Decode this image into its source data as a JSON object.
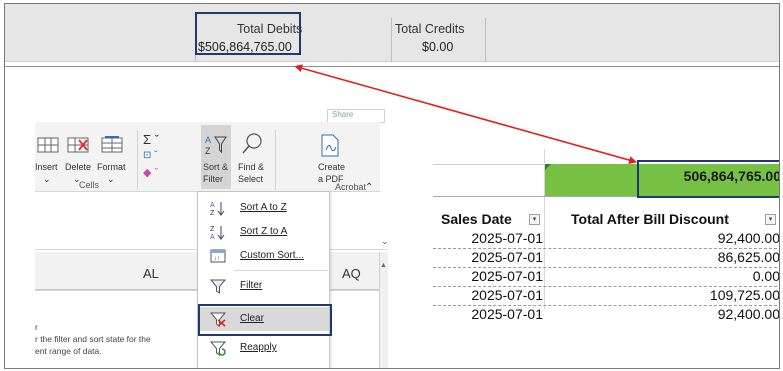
{
  "totals": {
    "debits_label": "Total Debits",
    "debits_value": "$506,864,765.00",
    "credits_label": "Total Credits",
    "credits_value": "$0.00"
  },
  "ribbon": {
    "share_label": "Share",
    "insert": "Insert",
    "delete": "Delete",
    "format": "Format",
    "cells_group": "Cells",
    "sort_filter_1": "Sort &",
    "sort_filter_2": "Filter",
    "find_select_1": "Find &",
    "find_select_2": "Select",
    "create_pdf_1": "Create",
    "create_pdf_2": "a PDF",
    "acrobat_group": "Acrobat"
  },
  "menu": {
    "items": [
      {
        "label": "Sort A to Z",
        "icon": "sort-az-icon"
      },
      {
        "label": "Sort Z to A",
        "icon": "sort-za-icon"
      },
      {
        "label": "Custom Sort...",
        "icon": "custom-sort-icon"
      },
      {
        "label": "Filter",
        "icon": "filter-icon"
      },
      {
        "label": "Clear",
        "icon": "clear-filter-icon"
      },
      {
        "label": "Reapply",
        "icon": "reapply-icon"
      }
    ]
  },
  "sheet_left": {
    "col_al": "AL",
    "col_aq": "AQ",
    "tip_1": "r",
    "tip_2": "r the filter and sort state for the",
    "tip_3": "ent range of data."
  },
  "sheet_right": {
    "total_value": "506,864,765.00",
    "header_date": "Sales Date",
    "header_total": "Total After Bill Discount",
    "rows": [
      {
        "date": "2025-07-01",
        "value": "92,400.00"
      },
      {
        "date": "2025-07-01",
        "value": "86,625.00"
      },
      {
        "date": "2025-07-01",
        "value": "0.00"
      },
      {
        "date": "2025-07-01",
        "value": "109,725.00"
      },
      {
        "date": "2025-07-01",
        "value": "92,400.00"
      }
    ]
  },
  "colors": {
    "highlight_box": "#1f3a6e",
    "arrow": "#e02020",
    "total_fill": "#76c043"
  }
}
